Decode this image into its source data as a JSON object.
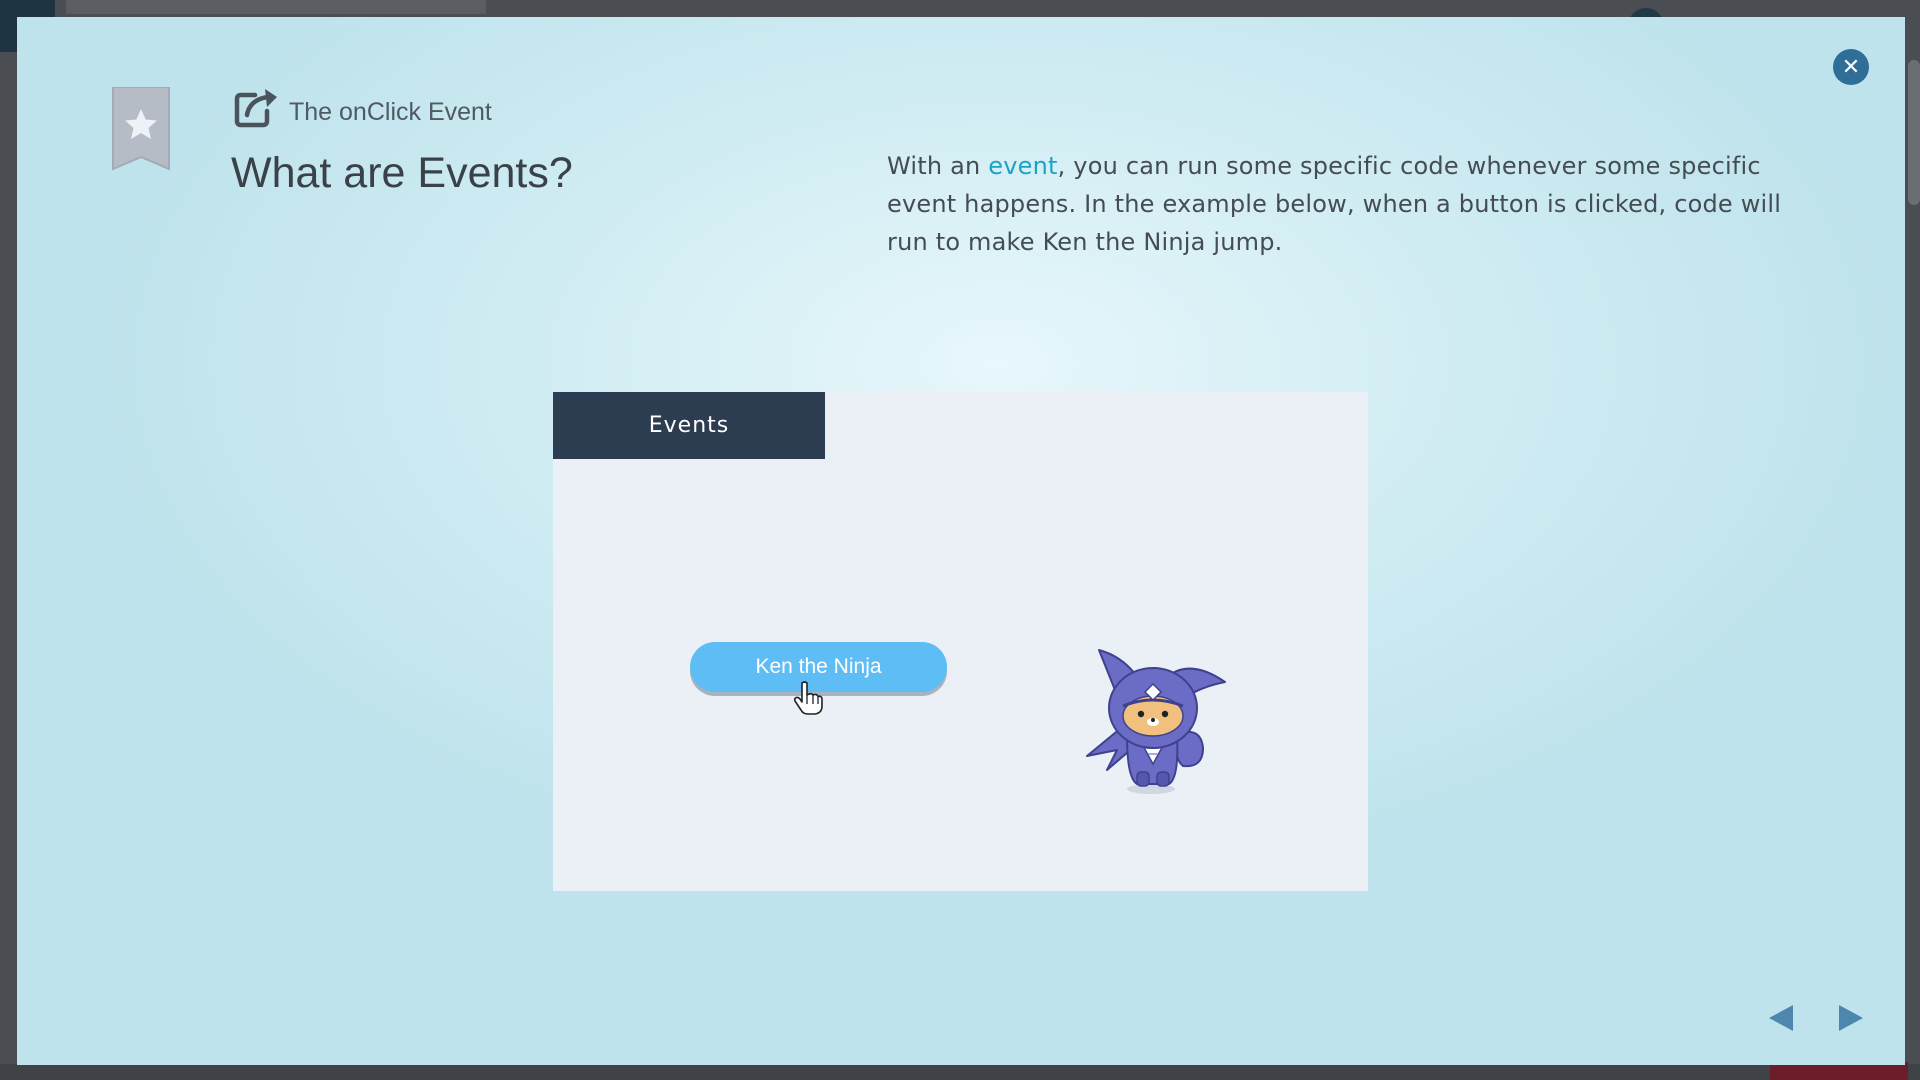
{
  "lesson": {
    "chapter_title": "The onClick Event",
    "page_title": "What are Events?",
    "description": {
      "before_link": "With an ",
      "link_text": "event",
      "after_link": ", you can run some specific code whenever some specific event happens. In the example below, when a button is clicked, code will run to make Ken the Ninja jump."
    }
  },
  "demo": {
    "header_label": "Events",
    "button_label": "Ken the Ninja"
  },
  "icons": {
    "close": "close-icon",
    "bookmark": "bookmark-star-icon",
    "external": "external-link-icon",
    "prev": "triangle-left-icon",
    "next": "triangle-right-icon",
    "cursor": "hand-pointer-icon"
  },
  "colors": {
    "accent_link": "#1aa3c8",
    "demo_header_bg": "#2c3d51",
    "demo_button_bg": "#5fbdf5",
    "close_button_bg": "#2f6e96",
    "ninja_purple": "#6a6cc6"
  }
}
